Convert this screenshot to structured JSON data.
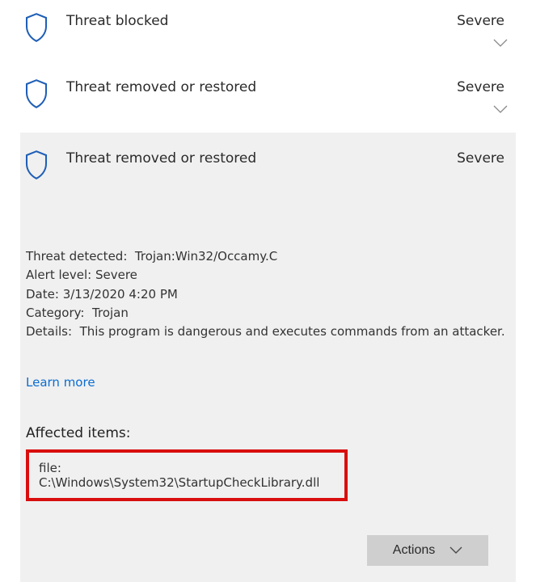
{
  "threats": [
    {
      "title": "Threat blocked",
      "severity": "Severe"
    },
    {
      "title": "Threat removed or restored",
      "severity": "Severe"
    }
  ],
  "expanded": {
    "title": "Threat removed or restored",
    "severity": "Severe",
    "detected_label": "Threat detected:",
    "detected_value": "Trojan:Win32/Occamy.C",
    "alert_label": "Alert level:",
    "alert_value": "Severe",
    "date_label": "Date:",
    "date_value": "3/13/2020 4:20 PM",
    "category_label": "Category:",
    "category_value": "Trojan",
    "details_label": "Details:",
    "details_value": "This program is dangerous and executes commands from an attacker.",
    "learn_more": "Learn more",
    "affected_heading": "Affected items:",
    "affected_item": "file: C:\\Windows\\System32\\StartupCheckLibrary.dll",
    "actions_label": "Actions"
  }
}
